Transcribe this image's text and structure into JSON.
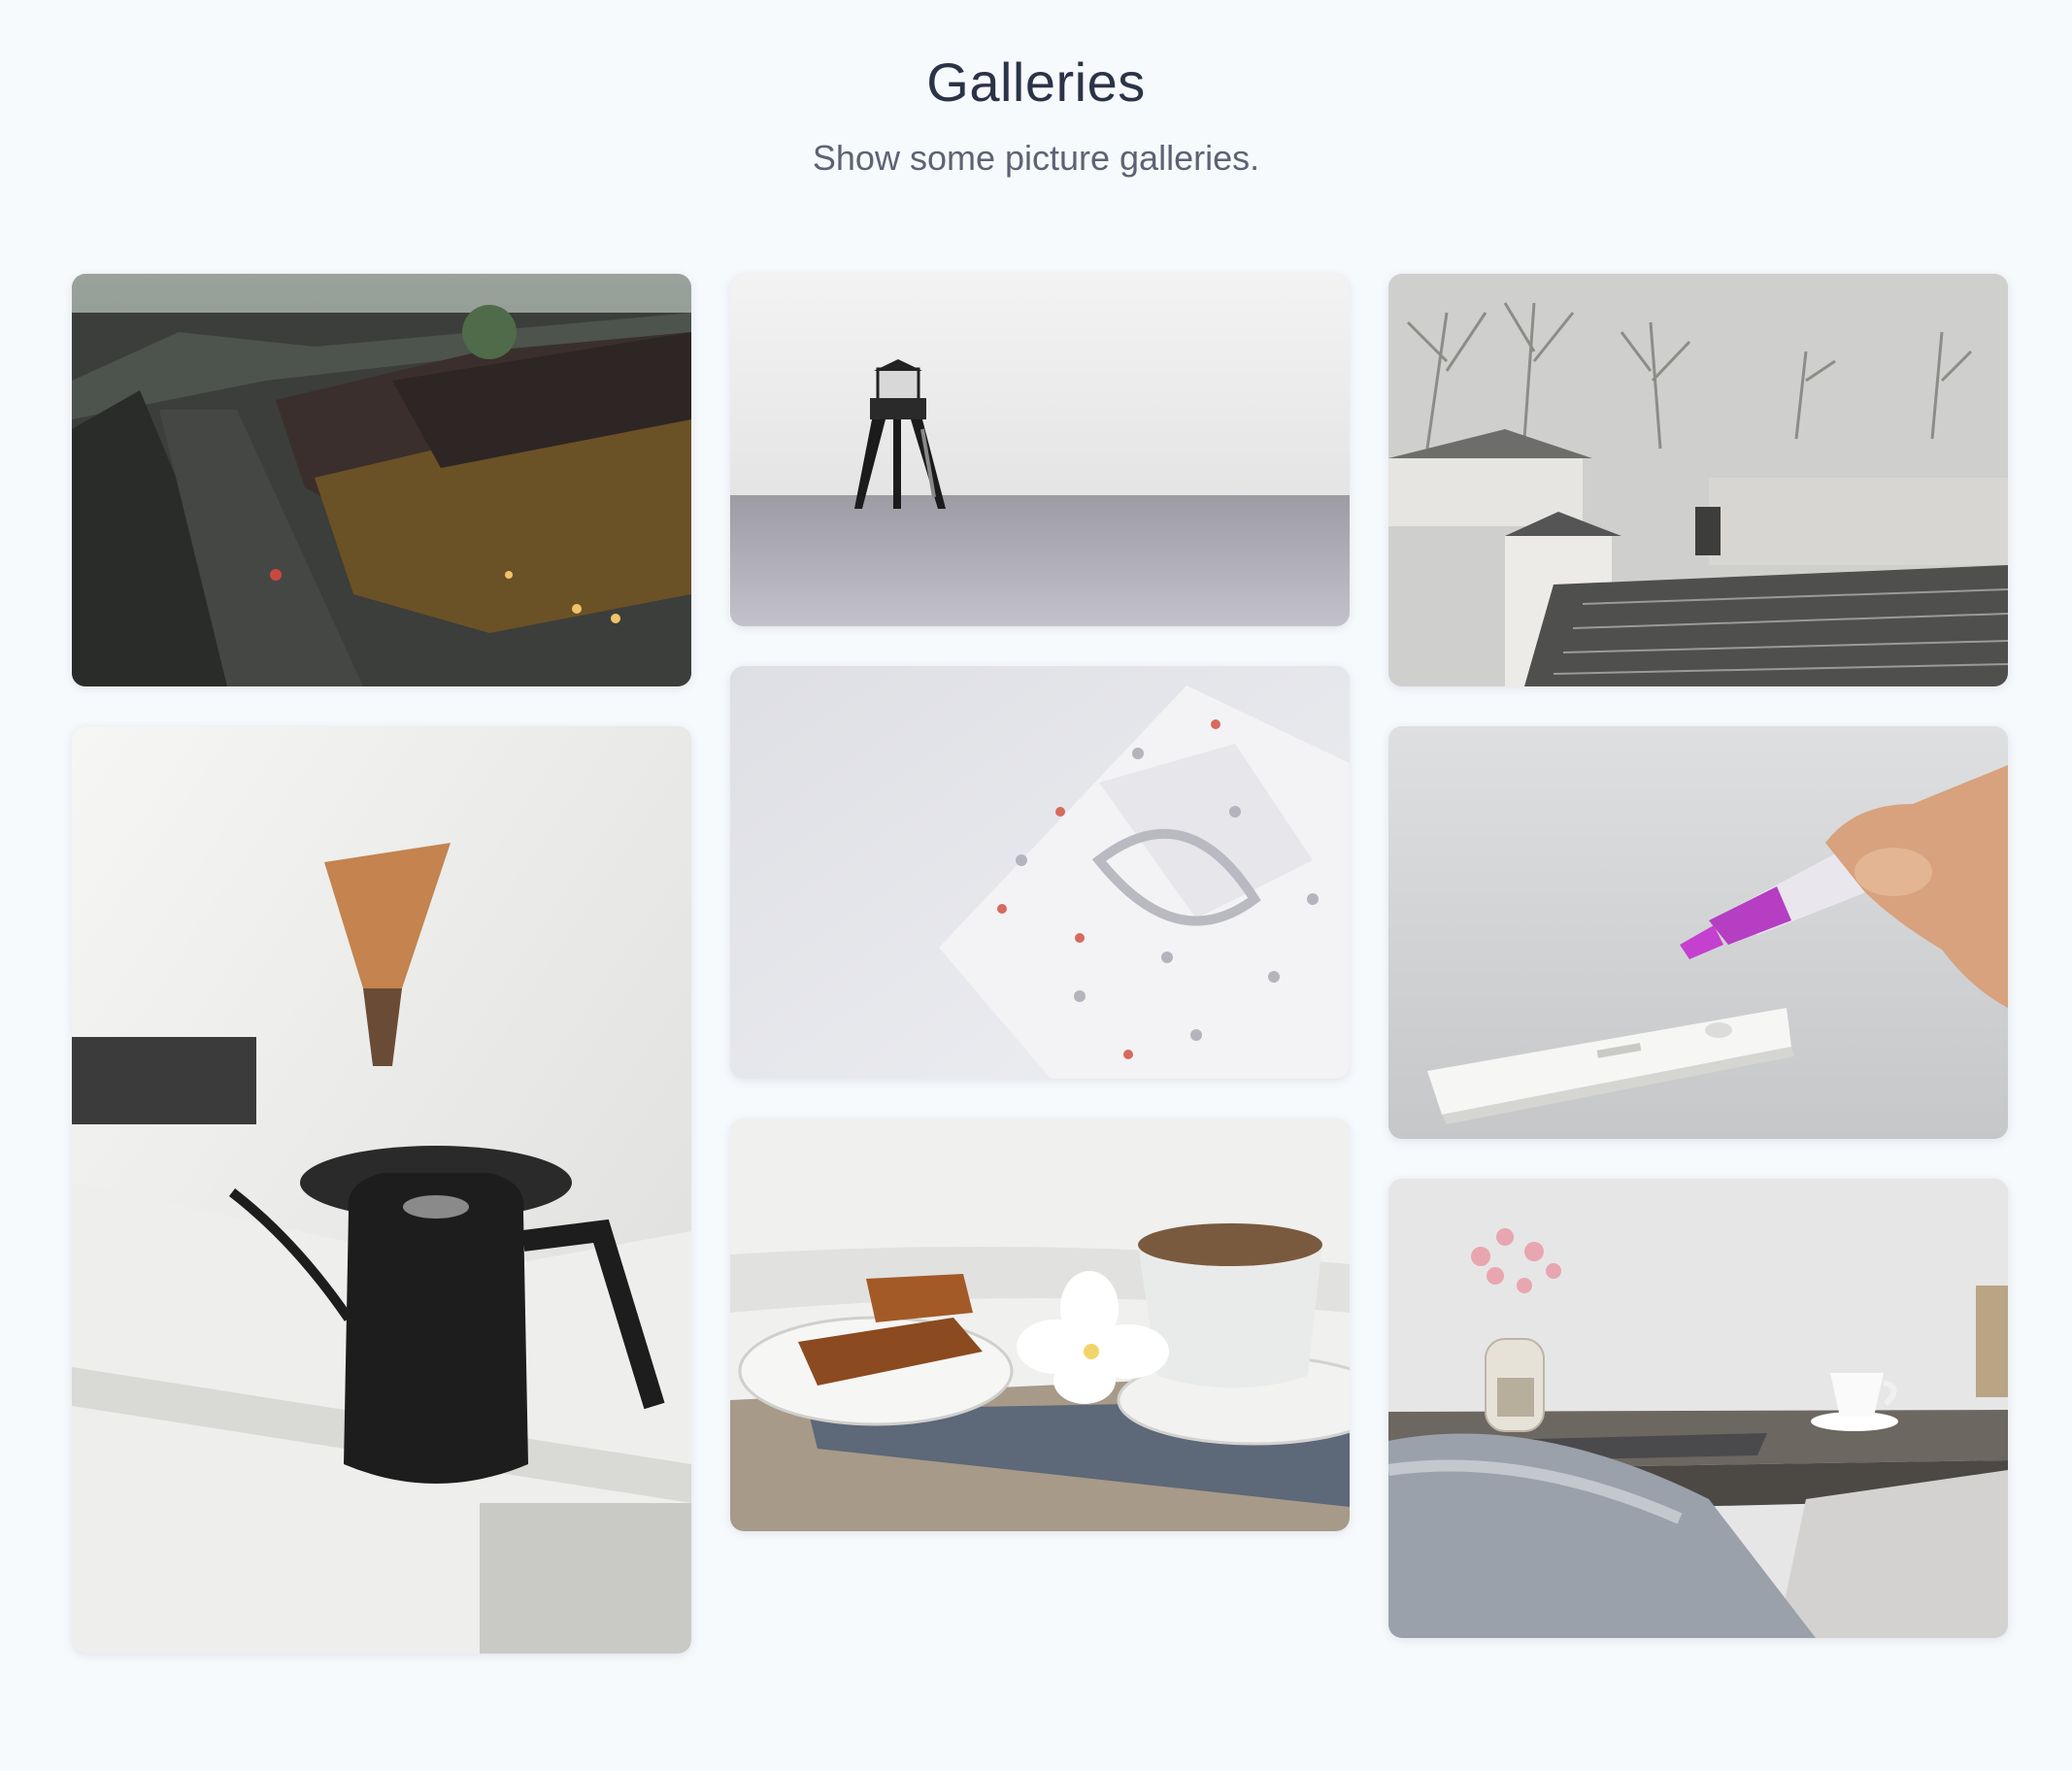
{
  "page": {
    "title": "Galleries",
    "subtitle": "Show some picture galleries."
  },
  "gallery": {
    "images": [
      {
        "subject": "rainy-village-street-rooftops"
      },
      {
        "subject": "lighthouse-in-calm-sea"
      },
      {
        "subject": "misty-village-tile-roofs"
      },
      {
        "subject": "coffee-kettle-pour-over"
      },
      {
        "subject": "wrapped-gift-star-paper"
      },
      {
        "subject": "hand-with-test-kit"
      },
      {
        "subject": "breakfast-coffee-cake-orchid"
      },
      {
        "subject": "desk-with-chair-and-flowers"
      }
    ]
  },
  "colors": {
    "background": "#f7fafd",
    "title": "#2b3348",
    "subtitle": "#5d6374"
  }
}
